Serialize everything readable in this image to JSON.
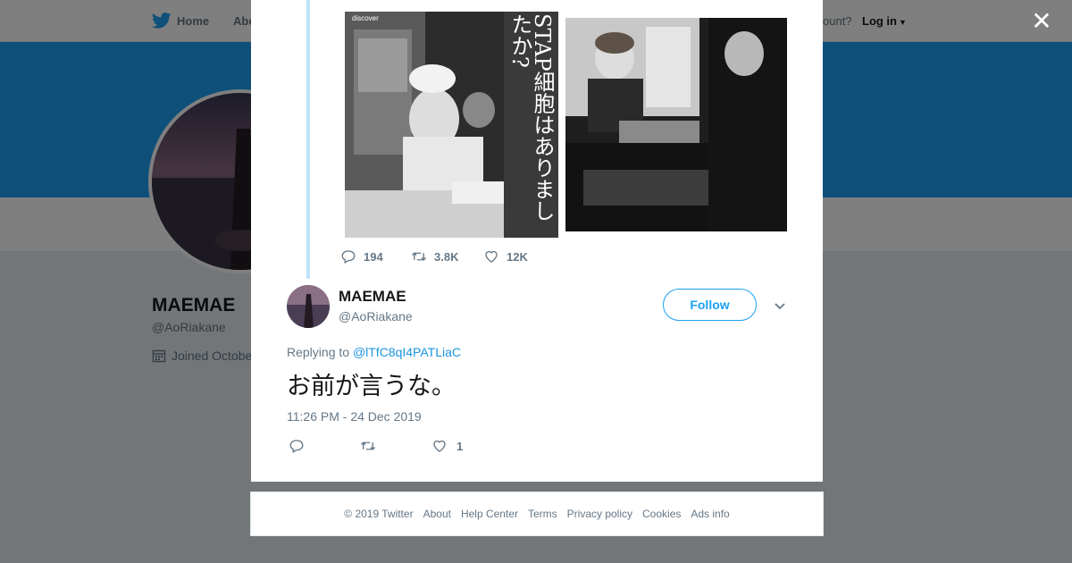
{
  "nav": {
    "home_label": "Home",
    "about_label": "Abo",
    "account_prompt": "ccount?",
    "login_label": "Log in"
  },
  "profile": {
    "name": "MAEMAE",
    "handle": "@AoRiakane",
    "joined": "Joined Octobe"
  },
  "quoted_tweet": {
    "replies": "194",
    "retweets": "3.8K",
    "likes": "12K",
    "magazine_headline": "STAP細胞はありましたか?",
    "magazine_brand": "discover"
  },
  "tweet": {
    "name": "MAEMAE",
    "handle": "@AoRiakane",
    "follow_label": "Follow",
    "replying_prefix": "Replying to",
    "replying_handle": "@lTfC8qI4PATLiaC",
    "text": "お前が言うな。",
    "timestamp": "11:26 PM - 24 Dec 2019",
    "like_count": "1"
  },
  "footer": {
    "copyright": "© 2019 Twitter",
    "links": [
      "About",
      "Help Center",
      "Terms",
      "Privacy policy",
      "Cookies",
      "Ads info"
    ]
  },
  "colors": {
    "brand_blue": "#1da1f2",
    "link_blue": "#1b95e0",
    "thread_line": "#bde3fa",
    "muted_text": "#657786"
  },
  "icons": {
    "close": "close-icon",
    "logo": "twitter-bird-icon",
    "reply": "reply-icon",
    "retweet": "retweet-icon",
    "like": "heart-icon",
    "caret": "chevron-down-icon",
    "calendar": "calendar-icon"
  }
}
